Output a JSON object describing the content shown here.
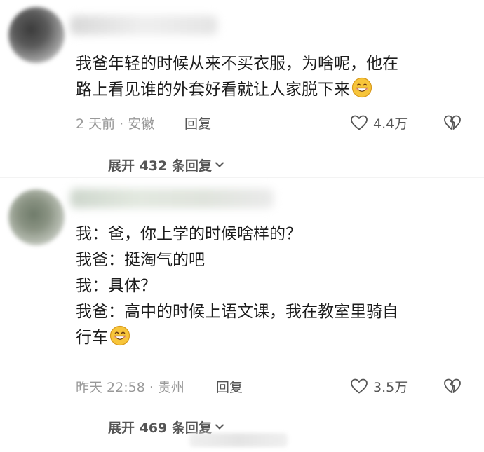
{
  "comments": [
    {
      "text_lines": [
        "我爸年轻的时候从来不买衣服，为啥呢，他在",
        "路上看见谁的外套好看就让人家脱下来"
      ],
      "time": "2 天前 · 安徽",
      "reply_label": "回复",
      "likes": "4.4万",
      "expand_label": "展开 432 条回复"
    },
    {
      "text_lines": [
        "我：爸，你上学的时候啥样的？",
        "我爸：挺淘气的吧",
        "我：具体？",
        "我爸：高中的时候上语文课，我在教室里骑自",
        "行车"
      ],
      "time": "昨天 22:58 · 贵州",
      "reply_label": "回复",
      "likes": "3.5万",
      "expand_label": "展开 469 条回复"
    }
  ],
  "icons": {
    "like": "heart-outline-icon",
    "dislike": "broken-heart-icon",
    "expand": "chevron-down-icon",
    "emoji": "grinning-face-emoji"
  },
  "colors": {
    "text": "#1c1c1c",
    "meta": "#999999",
    "action": "#555555",
    "emoji_face": "#f7c53a"
  }
}
